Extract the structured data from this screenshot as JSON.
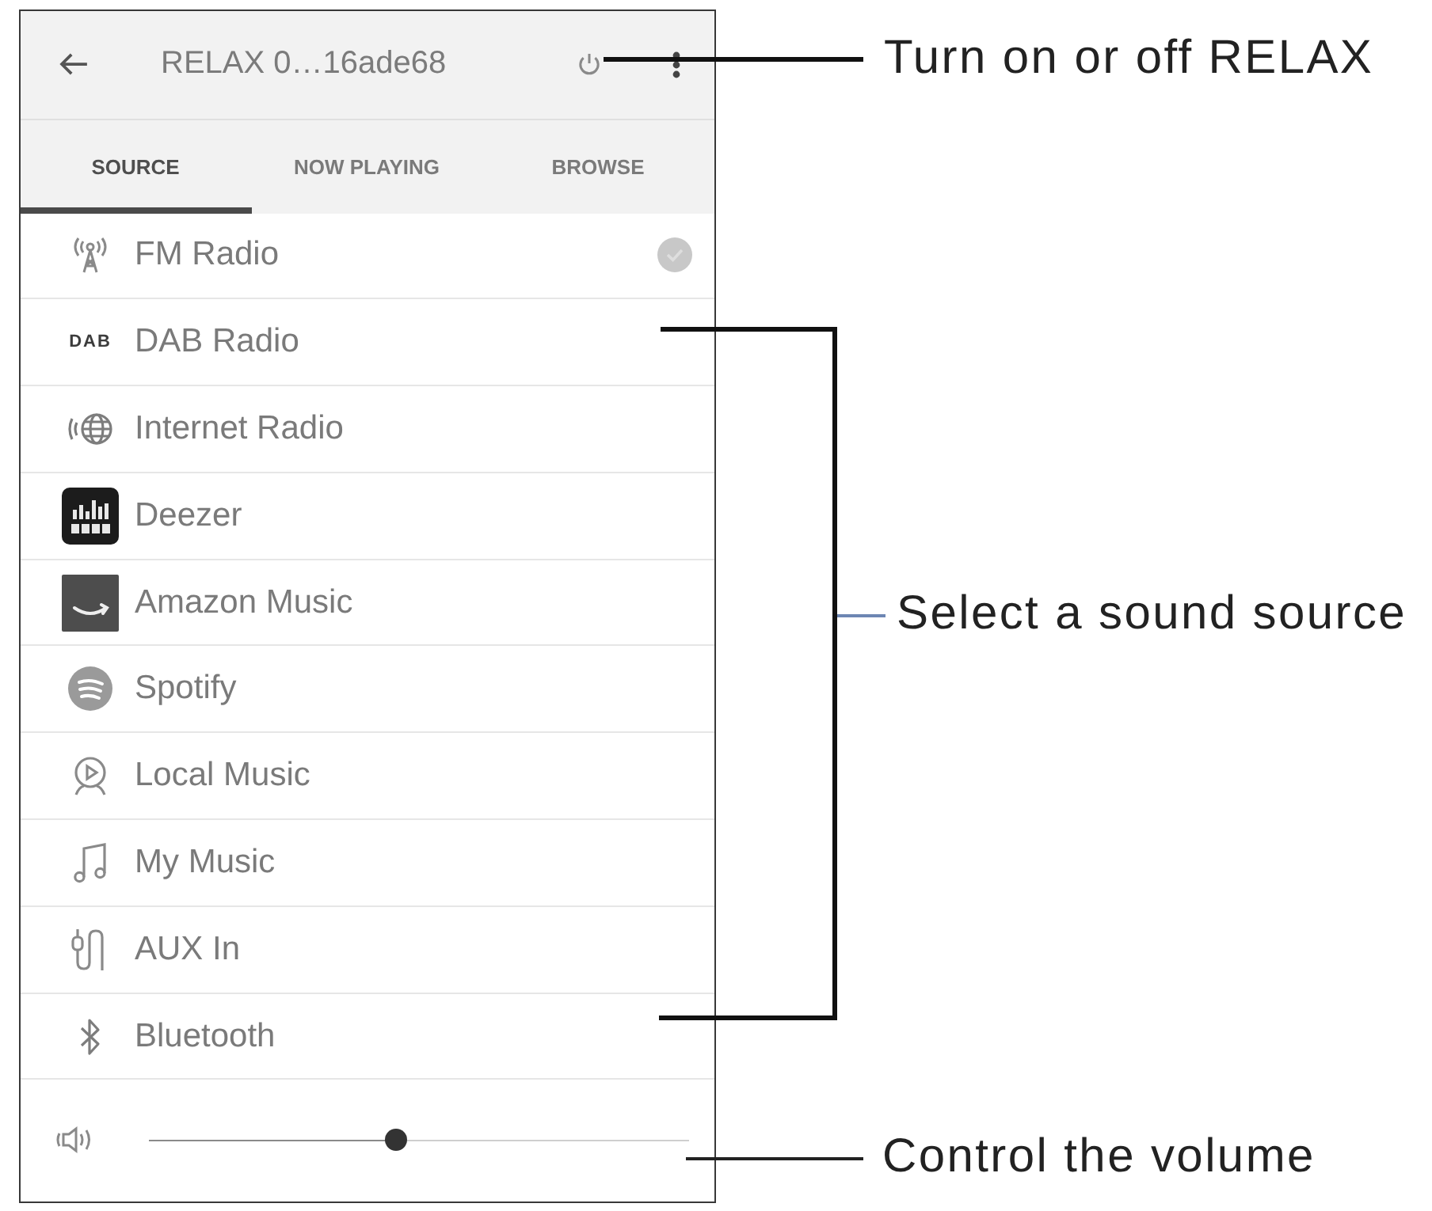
{
  "app_bar": {
    "title": "RELAX 0…16ade68"
  },
  "tabs": [
    {
      "label": "SOURCE",
      "selected": true
    },
    {
      "label": "NOW PLAYING",
      "selected": false
    },
    {
      "label": "BROWSE",
      "selected": false
    }
  ],
  "sources": [
    {
      "kind": "fm",
      "label": "FM Radio",
      "selected": true
    },
    {
      "kind": "dab",
      "label": "DAB Radio",
      "logo_text": "DAB",
      "selected": false
    },
    {
      "kind": "internet",
      "label": "Internet Radio",
      "selected": false
    },
    {
      "kind": "deezer",
      "label": "Deezer",
      "selected": false
    },
    {
      "kind": "amazon",
      "label": "Amazon Music",
      "selected": false
    },
    {
      "kind": "spotify",
      "label": "Spotify",
      "selected": false
    },
    {
      "kind": "local",
      "label": "Local Music",
      "selected": false
    },
    {
      "kind": "mymusic",
      "label": "My Music",
      "selected": false
    },
    {
      "kind": "aux",
      "label": "AUX In",
      "selected": false
    },
    {
      "kind": "bluetooth",
      "label": "Bluetooth",
      "selected": false
    }
  ],
  "volume": {
    "level": 0.46
  },
  "callouts": [
    {
      "text": "Turn on or off RELAX"
    },
    {
      "text": "Select a sound source"
    },
    {
      "text": "Control the volume"
    }
  ]
}
